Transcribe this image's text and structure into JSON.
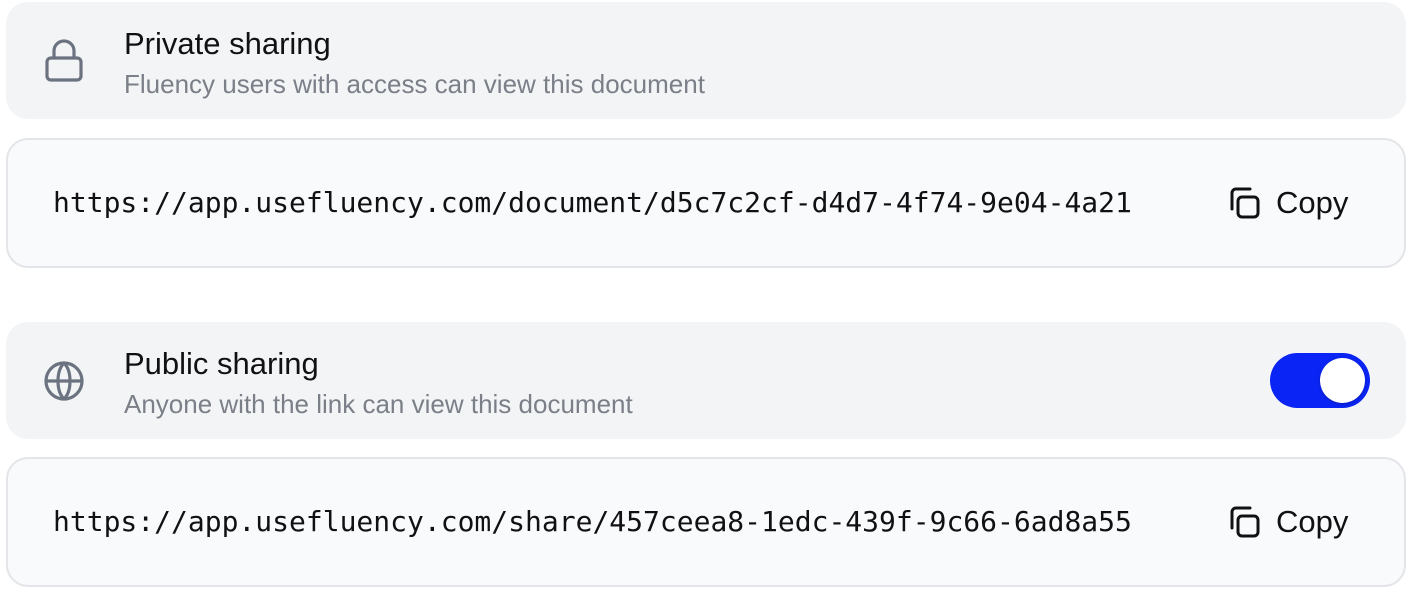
{
  "private_sharing": {
    "title": "Private sharing",
    "subtitle": "Fluency users with access can view this document",
    "icon": "lock-icon",
    "url": "https://app.usefluency.com/document/d5c7c2cf-d4d7-4f74-9e04-4a21",
    "copy_label": "Copy"
  },
  "public_sharing": {
    "title": "Public sharing",
    "subtitle": "Anyone with the link can view this document",
    "icon": "globe-icon",
    "toggle_on": true,
    "url": "https://app.usefluency.com/share/457ceea8-1edc-439f-9c66-6ad8a55",
    "copy_label": "Copy"
  },
  "colors": {
    "panel_bg": "#f3f4f6",
    "link_bg": "#f9fafb",
    "toggle_accent": "#0a24f5",
    "subtitle_text": "#7a7f88"
  }
}
